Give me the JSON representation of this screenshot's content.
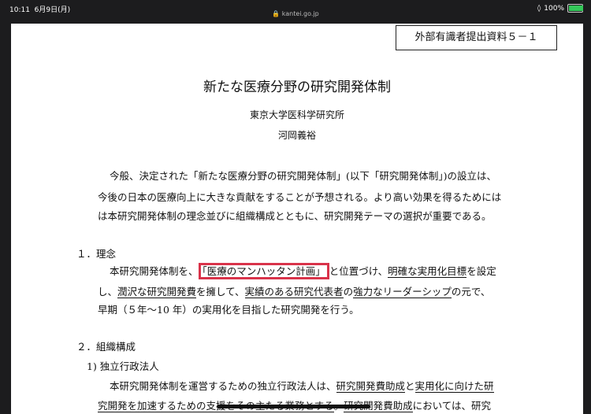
{
  "status_bar": {
    "time": "10:11",
    "date": "6月9日(月)",
    "url": "kantei.go.jp",
    "battery": "100%",
    "battery_level": 1.0
  },
  "document": {
    "label": "外部有識者提出資料５－１",
    "title": "新たな医療分野の研究開発体制",
    "affiliation": "東京大学医科学研究所",
    "author": "河岡義裕",
    "intro": [
      "今般、決定された「新たな医療分野の研究開発体制」(以下「研究開発体制」)の設立は、",
      "今後の日本の医療向上に大きな貢献をすることが予想される。より高い効果を得るためには",
      "は本研究開発体制の理念並びに組織構成とともに、研究開発テーマの選択が重要である。"
    ],
    "section1": {
      "heading": "１．理念",
      "l1_a": "本研究開発体制を、",
      "l1_box": "「医療のマンハッタン計画」",
      "l1_b": "と位置づけ、",
      "l1_u1": "明確な実用化目標",
      "l1_c": "を設定",
      "l2_a": "し、",
      "l2_u1": "潤沢な研究開発費",
      "l2_b": "を擁して、",
      "l2_u2": "実績のある研究代表者",
      "l2_c": "の",
      "l2_u3": "強力なリーダーシップ",
      "l2_d": "の元で、",
      "l3": "早期（５年〜10 年）の実用化を目指した研究開発を行う。"
    },
    "section2": {
      "heading": "２．組織構成",
      "sub": "1) 独立行政法人",
      "l1_a": "本研究開発体制を運営するための独立行政法人は、",
      "l1_u1": "研究開発費助成",
      "l1_b": "と",
      "l1_u2": "実用化に向けた研",
      "l2_u1": "究開発を加速するための支援をその主たる業務とする",
      "l2_a": "。",
      "l2_u2": "研究開発費助成",
      "l2_b": "においては、研究"
    }
  }
}
